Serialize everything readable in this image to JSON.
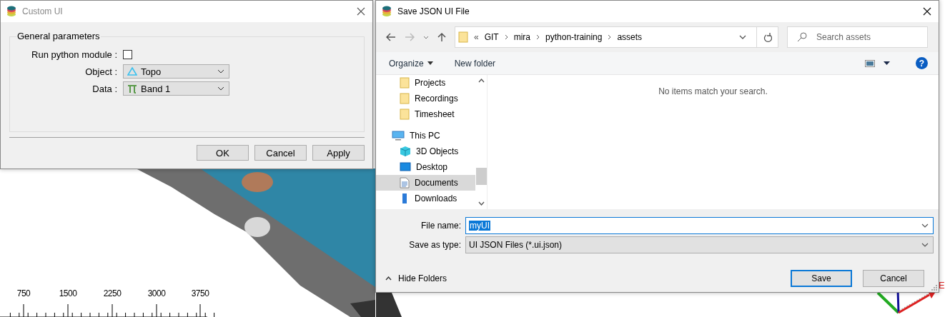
{
  "viewer": {
    "scale_labels": [
      "750",
      "1500",
      "2250",
      "3000",
      "3750"
    ],
    "axis_label": "E"
  },
  "custom_ui": {
    "title": "Custom UI",
    "group_title": "General parameters",
    "fields": [
      {
        "kind": "checkbox",
        "label": "Run python module :",
        "checked": false
      },
      {
        "kind": "object-combo",
        "label": "Object :",
        "value": "Topo"
      },
      {
        "kind": "data-combo",
        "label": "Data :",
        "value": "Band 1"
      }
    ],
    "buttons": [
      "OK",
      "Cancel",
      "Apply"
    ]
  },
  "save_dialog": {
    "title": "Save JSON UI File",
    "breadcrumb_overflow": "«",
    "breadcrumb": [
      "GIT",
      "mira",
      "python-training",
      "assets"
    ],
    "search": {
      "placeholder": "Search assets"
    },
    "toolbar": {
      "organize": "Organize",
      "new_folder": "New folder",
      "help": "?"
    },
    "nav_items": [
      {
        "kind": "folder",
        "label": "Projects",
        "selected": false
      },
      {
        "kind": "folder",
        "label": "Recordings",
        "selected": false
      },
      {
        "kind": "folder",
        "label": "Timesheet",
        "selected": false
      },
      {
        "kind": "pc",
        "label": "This PC",
        "selected": false
      },
      {
        "kind": "cube",
        "label": "3D Objects",
        "selected": false
      },
      {
        "kind": "desktop",
        "label": "Desktop",
        "selected": false
      },
      {
        "kind": "document",
        "label": "Documents",
        "selected": true
      },
      {
        "kind": "download",
        "label": "Downloads",
        "selected": false
      }
    ],
    "empty_message": "No items match your search.",
    "file_name": {
      "label": "File name:",
      "value": "myUI",
      "value_selected": true
    },
    "save_type": {
      "label": "Save as type:",
      "value": "UI JSON Files (*.ui.json)"
    },
    "hide_folders": "Hide Folders",
    "buttons": [
      {
        "label": "Save",
        "default": true
      },
      {
        "label": "Cancel",
        "default": false
      }
    ]
  }
}
